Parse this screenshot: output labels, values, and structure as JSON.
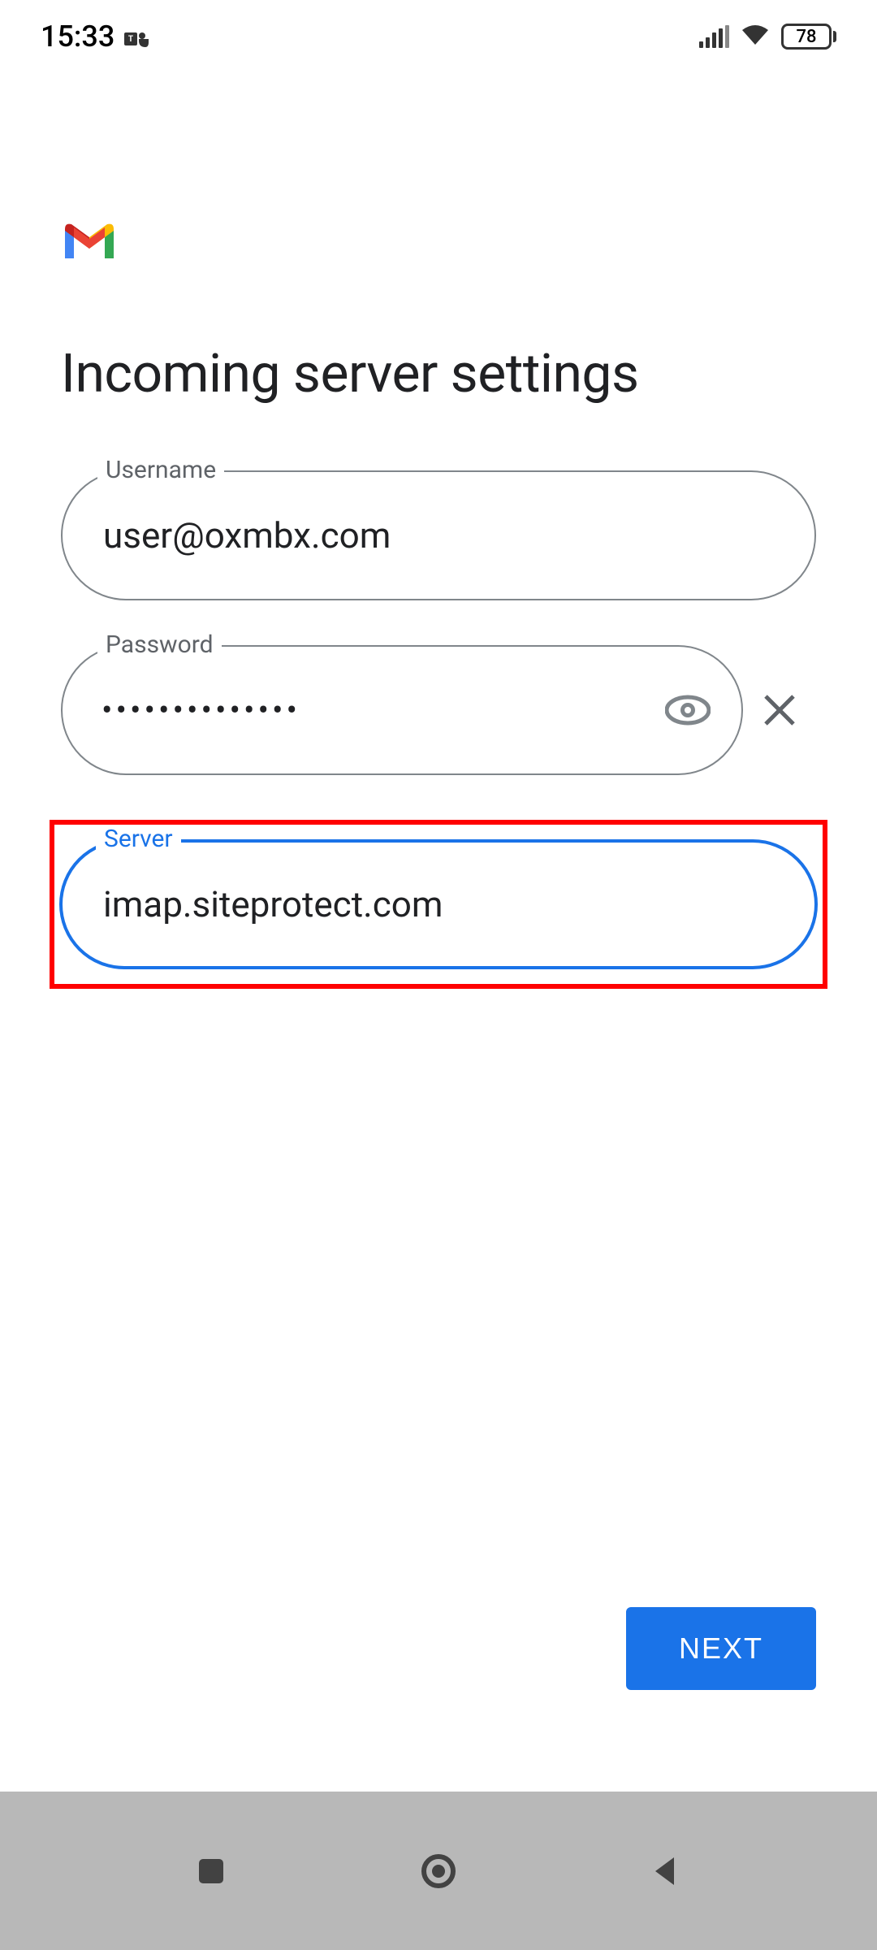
{
  "status_bar": {
    "time": "15:33",
    "battery_percent": "78"
  },
  "page": {
    "title": "Incoming server settings"
  },
  "fields": {
    "username": {
      "label": "Username",
      "value": "user@oxmbx.com"
    },
    "password": {
      "label": "Password",
      "value_masked": "••••••••••••••"
    },
    "server": {
      "label": "Server",
      "value": "imap.siteprotect.com"
    }
  },
  "buttons": {
    "next": "NEXT"
  }
}
